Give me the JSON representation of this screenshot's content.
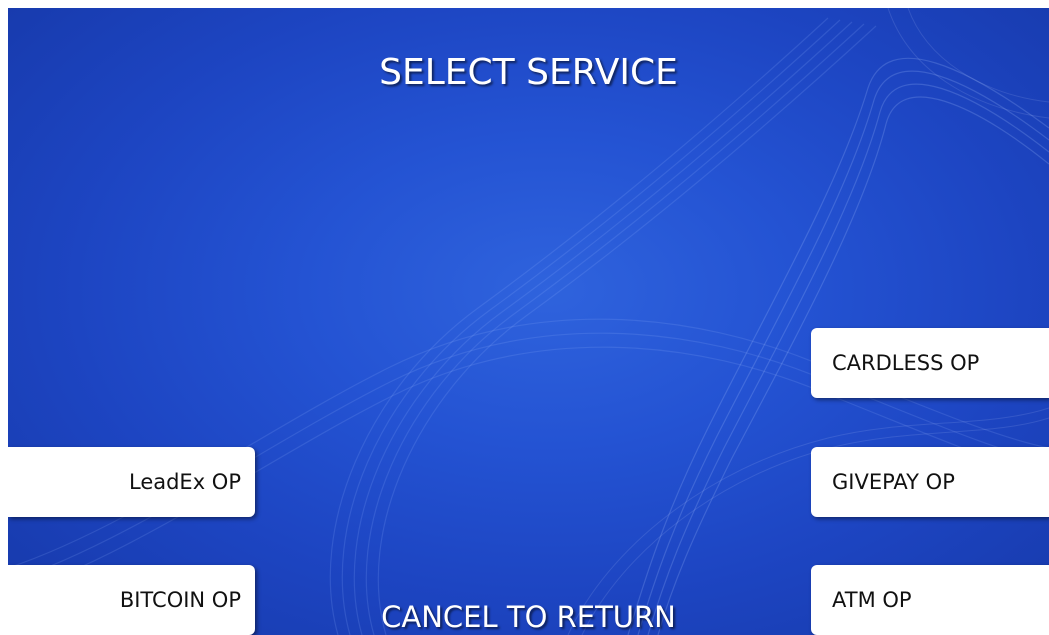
{
  "screen": {
    "title": "SELECT SERVICE",
    "cancel_text": "CANCEL TO RETURN"
  },
  "left_buttons": [
    {
      "label": "LeadEx OP"
    },
    {
      "label": "BITCOIN OP"
    }
  ],
  "right_buttons": [
    {
      "label": "CARDLESS OP"
    },
    {
      "label": "GIVEPAY OP"
    },
    {
      "label": "ATM OP"
    }
  ],
  "colors": {
    "background": "#2453d3",
    "button": "#ffffff",
    "text_light": "#ffffff",
    "text_dark": "#111111"
  }
}
